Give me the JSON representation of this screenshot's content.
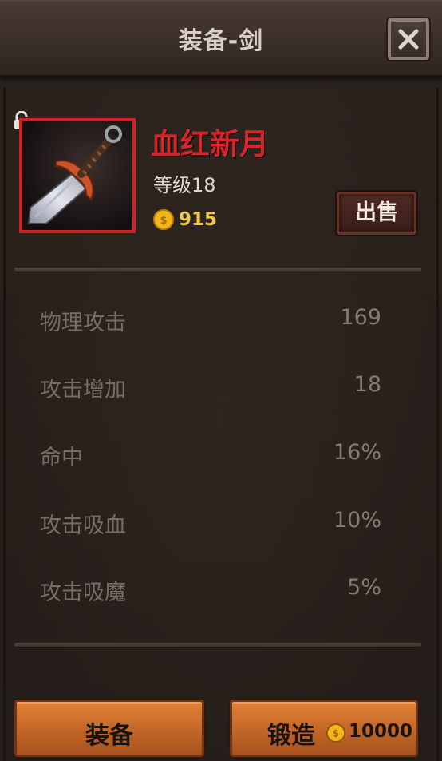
{
  "window": {
    "title": "装备-剑"
  },
  "item": {
    "name": "血红新月",
    "level_text": "等级18",
    "price": "915",
    "icon": "sword-icon",
    "locked": false
  },
  "actions": {
    "sell_label": "出售",
    "equip_label": "装备",
    "forge_label": "锻造",
    "forge_cost": "10000"
  },
  "stats": [
    {
      "label": "物理攻击",
      "value": "169"
    },
    {
      "label": "攻击增加",
      "value": "18"
    },
    {
      "label": "命中",
      "value": "16%"
    },
    {
      "label": "攻击吸血",
      "value": "10%"
    },
    {
      "label": "攻击吸魔",
      "value": "5%"
    }
  ],
  "colors": {
    "item_name": "#d7262b",
    "frame": "#d32027",
    "coin": "#f0c843",
    "button": "#c86a29"
  }
}
